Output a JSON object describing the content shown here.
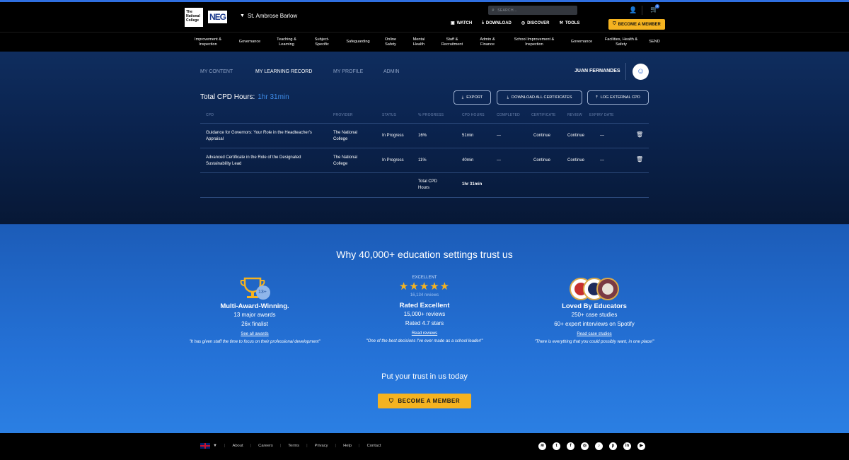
{
  "header": {
    "logo_tnc_text": "The National College",
    "logo_neg_text": "NEG",
    "school_name": "St. Ambrose Barlow",
    "search_placeholder": "SEARCH...",
    "cart_count": "0",
    "nav": [
      {
        "label": "WATCH",
        "icon": "tv-icon",
        "glyph": "▣"
      },
      {
        "label": "DOWNLOAD",
        "icon": "download-icon",
        "glyph": "⤓"
      },
      {
        "label": "DISCOVER",
        "icon": "compass-icon",
        "glyph": "◎"
      },
      {
        "label": "TOOLS",
        "icon": "tools-icon",
        "glyph": "⚒"
      }
    ],
    "become_member": "BECOME A MEMBER"
  },
  "categories": [
    "Improvement & Inspection",
    "Governance",
    "Teaching & Learning",
    "Subject-Specific",
    "Safeguarding",
    "Online Safety",
    "Mental Health",
    "Staff & Recruitment",
    "Admin & Finance",
    "School Improvement & Inspection",
    "Governance",
    "Facilities, Health & Safety",
    "SEND"
  ],
  "tabs": [
    "MY CONTENT",
    "MY LEARNING RECORD",
    "MY PROFILE",
    "ADMIN"
  ],
  "user_name": "JUAN FERNANDES",
  "cpd": {
    "total_label": "Total CPD Hours:",
    "total_value": "1hr 31min",
    "buttons": {
      "export": "EXPORT",
      "download": "DOWNLOAD ALL CERTIFICATES",
      "log": "LOG EXTERNAL CPD"
    },
    "columns": [
      "CPD",
      "PROVIDER",
      "STATUS",
      "% PROGRESS",
      "CPD HOURS",
      "COMPLETED",
      "CERTIFICATE",
      "REVIEW",
      "EXPIRY DATE"
    ],
    "rows": [
      {
        "cpd": "Guidance for Governors: Your Role in the Headteacher's Appraisal",
        "provider": "The National College",
        "status": "In Progress",
        "progress": "16%",
        "hours": "51min",
        "completed": "—",
        "certificate": "Continue",
        "review": "Continue",
        "expiry": "—"
      },
      {
        "cpd": "Advanced Certificate in the Role of the Designated Sustainability Lead",
        "provider": "The National College",
        "status": "In Progress",
        "progress": "11%",
        "hours": "40min",
        "completed": "—",
        "certificate": "Continue",
        "review": "Continue",
        "expiry": "—"
      }
    ],
    "footer_label": "Total CPD Hours",
    "footer_value": "1hr 31min"
  },
  "trust": {
    "title": "Why 40,000+ education settings trust us",
    "awards": {
      "badge": "13+",
      "heading": "Multi-Award-Winning.",
      "line1": "13 major awards",
      "line2": "26x finalist",
      "link": "See all awards",
      "quote": "\"It has given staff the time to focus on their professional development\""
    },
    "rated": {
      "excellent": "EXCELLENT",
      "reviews_count": "16,134 reviews",
      "heading": "Rated Excellent",
      "line1": "15,000+ reviews",
      "line2": "Rated 4.7 stars",
      "link": "Read reviews",
      "quote": "\"One of the best decisions I've ever made as a school leader!\""
    },
    "loved": {
      "heading": "Loved By Educators",
      "line1": "250+ case studies",
      "line2": "60+ expert interviews on Spotify",
      "link": "Read case studies",
      "quote": "\"There is everything that you could possibly want, in one place!\""
    },
    "put_trust": "Put your trust in us today",
    "become_member": "BECOME A MEMBER"
  },
  "footer": {
    "links": [
      "About",
      "Careers",
      "Terms",
      "Privacy",
      "Help",
      "Contact"
    ],
    "socials": [
      "spotify-icon",
      "twitter-icon",
      "facebook-icon",
      "instagram-icon",
      "tiktok-icon",
      "pinterest-icon",
      "linkedin-icon",
      "youtube-icon"
    ]
  }
}
